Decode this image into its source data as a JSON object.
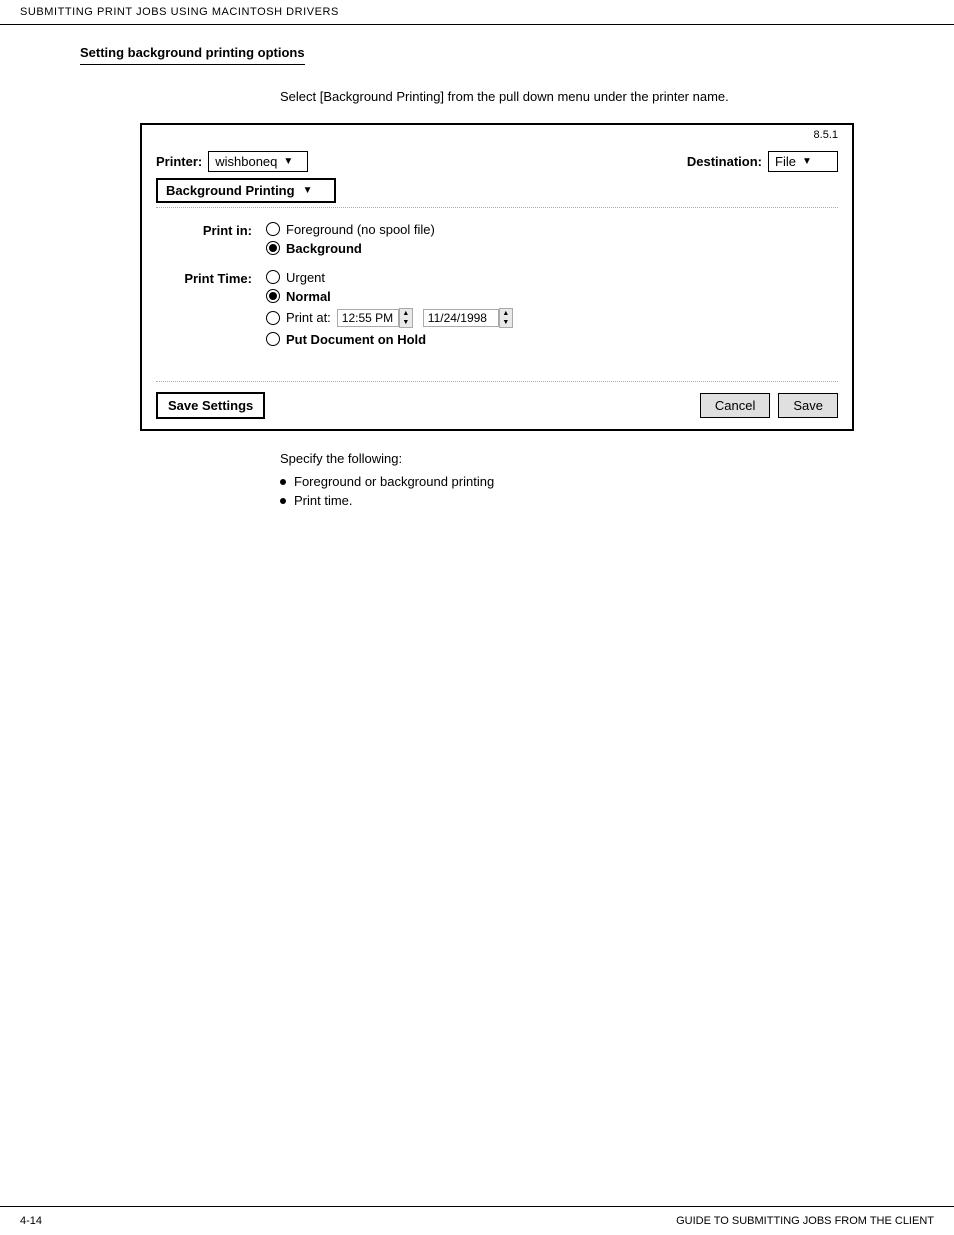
{
  "header": {
    "text": "SUBMITTING PRINT JOBS USING MACINTOSH DRIVERS"
  },
  "section": {
    "title": "Setting background printing options"
  },
  "intro": {
    "text": "Select [Background Printing] from the pull down menu under the printer name."
  },
  "dialog": {
    "version": "8.5.1",
    "printer_label": "Printer:",
    "printer_value": "wishboneq",
    "destination_label": "Destination:",
    "destination_value": "File",
    "bg_printing_label": "Background Printing",
    "print_in_label": "Print in:",
    "print_in_options": [
      {
        "label": "Foreground (no spool file)",
        "selected": false
      },
      {
        "label": "Background",
        "selected": true
      }
    ],
    "print_time_label": "Print Time:",
    "print_time_options": [
      {
        "label": "Urgent",
        "selected": false
      },
      {
        "label": "Normal",
        "selected": true
      },
      {
        "label": "Print at:",
        "selected": false,
        "is_print_at": true
      },
      {
        "label": "Put Document on Hold",
        "selected": false
      }
    ],
    "time_value": "12:55 PM",
    "date_value": "11/24/1998",
    "save_settings_label": "Save Settings",
    "cancel_label": "Cancel",
    "save_label": "Save"
  },
  "specify": {
    "intro": "Specify the following:",
    "items": [
      "Foreground or background printing",
      "Print time."
    ]
  },
  "footer": {
    "left": "4-14",
    "right": "GUIDE TO SUBMITTING JOBS FROM THE CLIENT"
  }
}
